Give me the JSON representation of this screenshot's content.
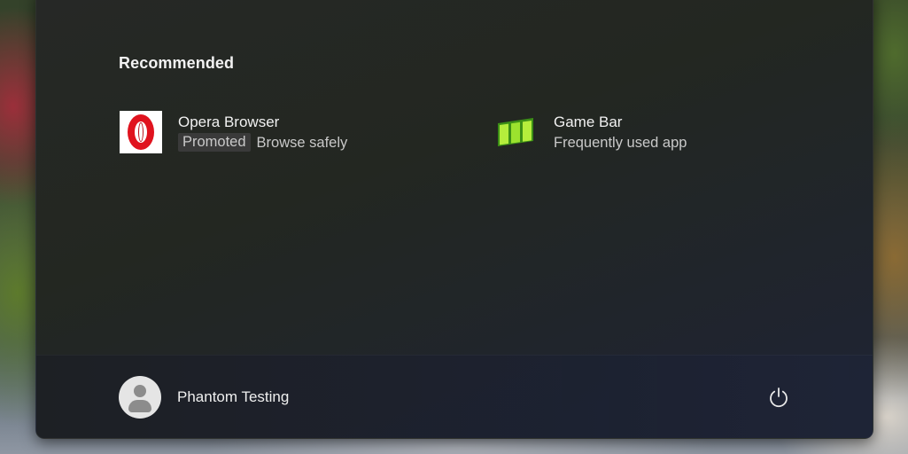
{
  "recommended": {
    "title": "Recommended",
    "items": [
      {
        "name": "Opera Browser",
        "badge": "Promoted",
        "subtitle": "Browse safely",
        "icon": "opera-icon",
        "icon_color": "#e0131e"
      },
      {
        "name": "Game Bar",
        "subtitle": "Frequently used app",
        "icon": "game-bar-icon",
        "icon_color": "#7ed321"
      }
    ]
  },
  "user": {
    "name": "Phantom Testing",
    "icon": "avatar-icon"
  },
  "power": {
    "icon": "power-icon"
  }
}
